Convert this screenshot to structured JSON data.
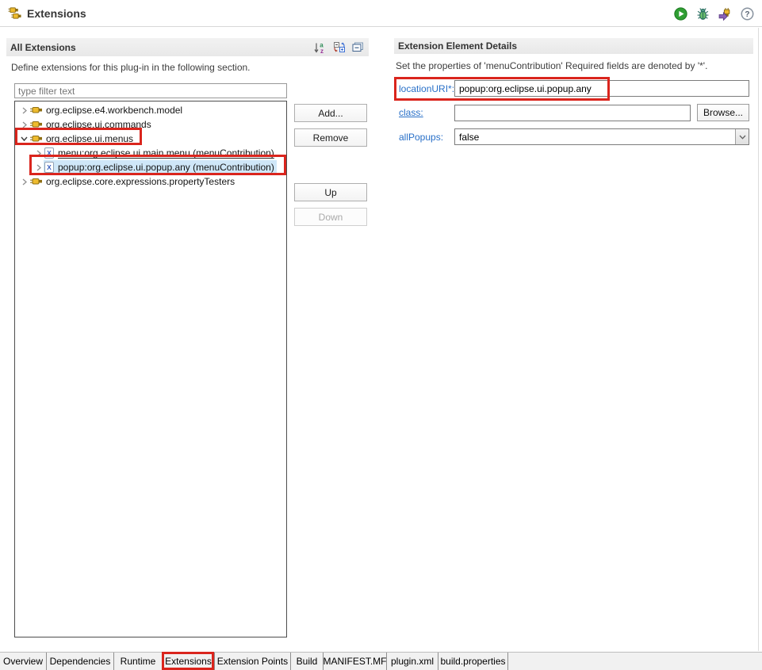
{
  "header": {
    "title": "Extensions",
    "toolbar_icons": [
      "run-icon",
      "debug-icon",
      "export-plugin-icon",
      "help-icon"
    ]
  },
  "all_extensions": {
    "section_title": "All Extensions",
    "description": "Define extensions for this plug-in in the following section.",
    "filter_placeholder": "type filter text",
    "toolbar_icons": [
      "sort-icon",
      "expand-collapse-icon",
      "collapse-section-icon"
    ],
    "tree": [
      {
        "label": "org.eclipse.e4.workbench.model",
        "level": 0,
        "state": "collapsed",
        "icon": "extension-point-icon"
      },
      {
        "label": "org.eclipse.ui.commands",
        "level": 0,
        "state": "collapsed",
        "icon": "extension-point-icon"
      },
      {
        "label": "org.eclipse.ui.menus",
        "level": 0,
        "state": "expanded",
        "icon": "extension-point-icon",
        "annotated": true
      },
      {
        "label": "menu:org.eclipse.ui.main.menu (menuContribution)",
        "level": 1,
        "state": "collapsed",
        "icon": "xml-element-icon",
        "underlined": true
      },
      {
        "label": "popup:org.eclipse.ui.popup.any (menuContribution)",
        "level": 1,
        "state": "collapsed",
        "icon": "xml-element-icon",
        "selected": true,
        "annotated": true
      },
      {
        "label": "org.eclipse.core.expressions.propertyTesters",
        "level": 0,
        "state": "collapsed",
        "icon": "extension-point-icon"
      }
    ],
    "buttons": [
      {
        "label": "Add...",
        "enabled": true
      },
      {
        "label": "Remove",
        "enabled": true
      },
      {
        "label": "Up",
        "enabled": true
      },
      {
        "label": "Down",
        "enabled": false
      }
    ]
  },
  "details": {
    "section_title": "Extension Element Details",
    "description": "Set the properties of 'menuContribution' Required fields are denoted by '*'.",
    "fields": [
      {
        "label": "locationURI*:",
        "value": "popup:org.eclipse.ui.popup.any",
        "type": "text",
        "annotated": true
      },
      {
        "label": "class:",
        "value": "",
        "type": "text",
        "button": "Browse...",
        "link": true
      },
      {
        "label": "allPopups:",
        "value": "false",
        "type": "dropdown"
      }
    ]
  },
  "bottom_tabs": {
    "active": "Extensions",
    "tabs": [
      "Overview",
      "Dependencies",
      "Runtime",
      "Extensions",
      "Extension Points",
      "Build",
      "MANIFEST.MF",
      "plugin.xml",
      "build.properties"
    ]
  },
  "colors": {
    "annotation_red": "#da251d",
    "label_blue": "#2970c8",
    "selection_blue": "#cfe7f8",
    "plug_gold": "#eebb2e"
  }
}
